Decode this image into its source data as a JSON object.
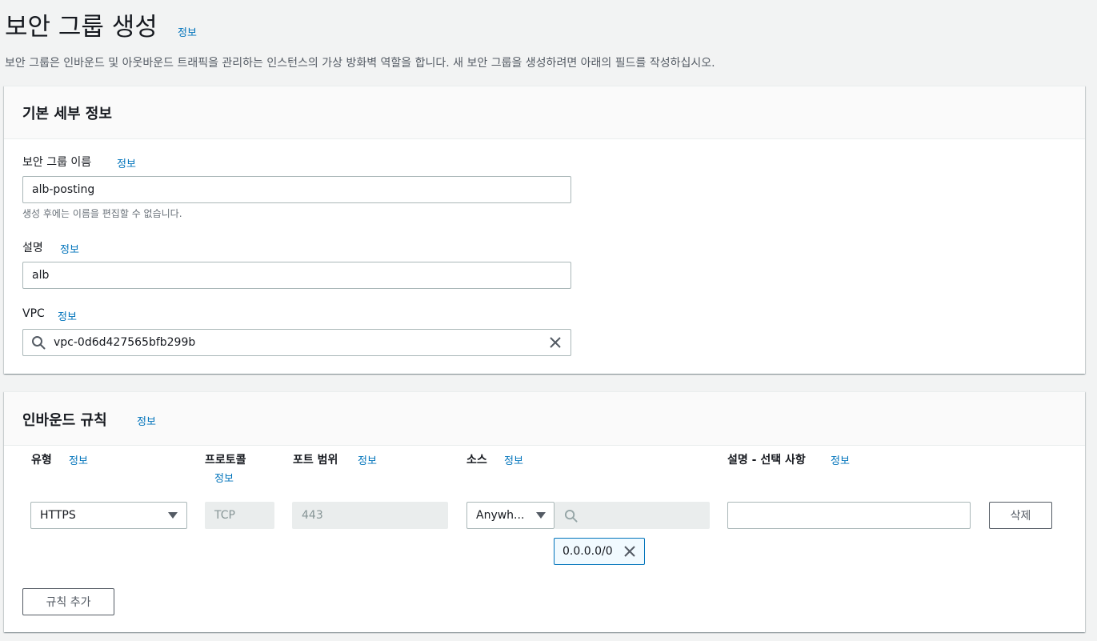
{
  "page": {
    "title": "보안 그룹 생성",
    "info": "정보",
    "description": "보안 그룹은 인바운드 및 아웃바운드 트래픽을 관리하는 인스턴스의 가상 방화벽 역할을 합니다. 새 보안 그룹을 생성하려면 아래의 필드를 작성하십시오."
  },
  "basic": {
    "title": "기본 세부 정보",
    "name_label": "보안 그룹 이름",
    "name_info": "정보",
    "name_value": "alb-posting",
    "name_hint": "생성 후에는 이름을 편집할 수 없습니다.",
    "desc_label": "설명",
    "desc_info": "정보",
    "desc_value": "alb",
    "vpc_label": "VPC",
    "vpc_info": "정보",
    "vpc_value": "vpc-0d6d427565bfb299b"
  },
  "inbound": {
    "title": "인바운드 규칙",
    "info": "정보",
    "columns": {
      "type": "유형",
      "type_info": "정보",
      "protocol": "프로토콜",
      "protocol_info": "정보",
      "port": "포트 범위",
      "port_info": "정보",
      "source": "소스",
      "source_info": "정보",
      "desc": "설명 - 선택 사항",
      "desc_info": "정보"
    },
    "rule": {
      "type": "HTTPS",
      "protocol": "TCP",
      "port": "443",
      "source": "Anywh...",
      "source_search": "",
      "cidr": "0.0.0.0/0",
      "desc": "",
      "delete": "삭제"
    },
    "add_rule": "규칙 추가"
  }
}
